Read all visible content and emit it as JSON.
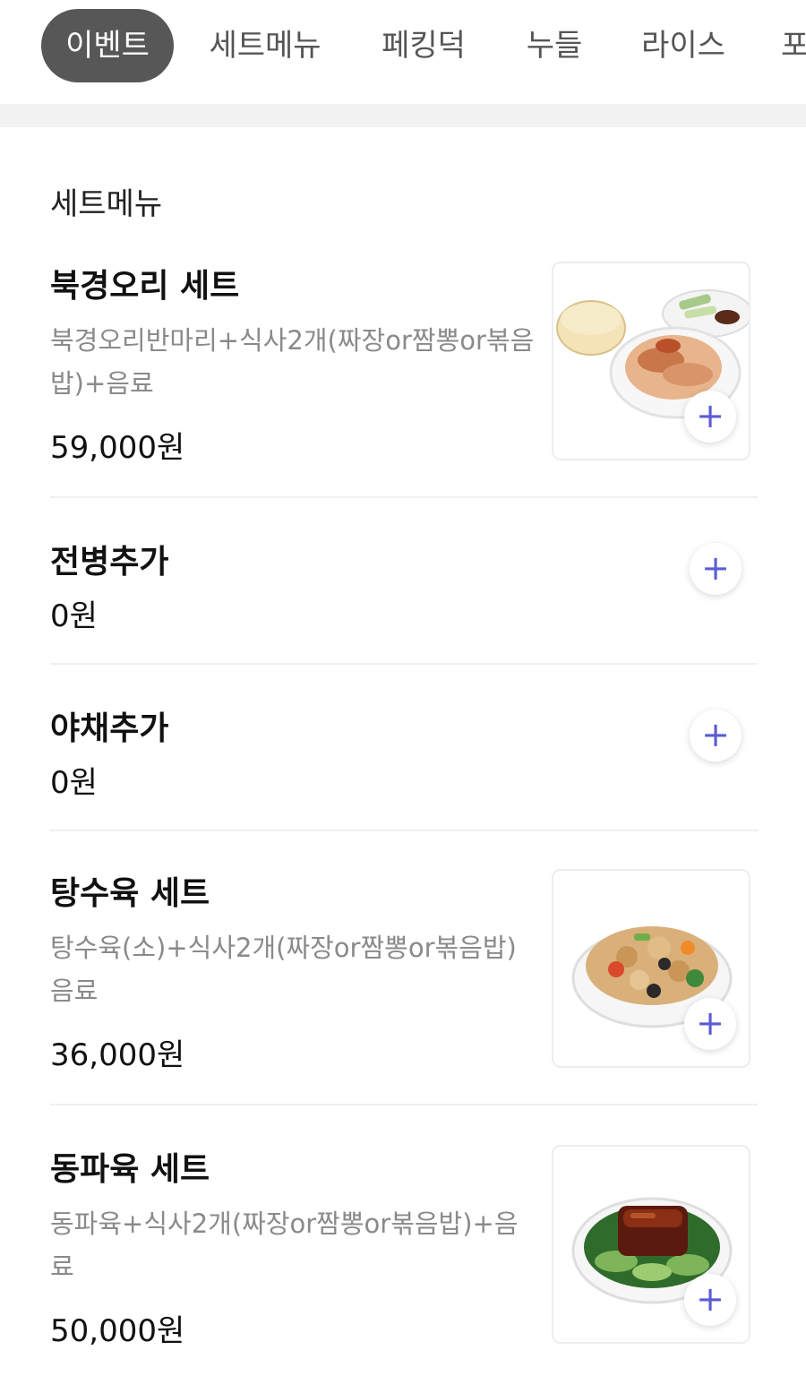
{
  "tabs": [
    {
      "label": "이벤트",
      "active": true
    },
    {
      "label": "세트메뉴",
      "active": false
    },
    {
      "label": "페킹덕",
      "active": false
    },
    {
      "label": "누들",
      "active": false
    },
    {
      "label": "라이스",
      "active": false
    },
    {
      "label": "포",
      "active": false
    }
  ],
  "section": {
    "title": "세트메뉴",
    "items": [
      {
        "name": "북경오리 세트",
        "description": "북경오리반마리+식사2개(짜장or짬뽕or볶음밥)+음료",
        "price": "59,000원",
        "has_image": true,
        "image_icon": "peking-duck-plate"
      },
      {
        "name": "전병추가",
        "description": "",
        "price": "0원",
        "has_image": false
      },
      {
        "name": "야채추가",
        "description": "",
        "price": "0원",
        "has_image": false
      },
      {
        "name": "탕수육 세트",
        "description": "탕수육(소)+식사2개(짜장or짬뽕or볶음밥)음료",
        "price": "36,000원",
        "has_image": true,
        "image_icon": "sweet-sour-pork-plate"
      },
      {
        "name": "동파육 세트",
        "description": "동파육+식사2개(짜장or짬뽕or볶음밥)+음료",
        "price": "50,000원",
        "has_image": true,
        "image_icon": "dongpo-pork-plate"
      }
    ]
  },
  "add_icon": "plus-icon",
  "colors": {
    "active_tab_bg": "#575757",
    "accent": "#5b5bd6",
    "muted_text": "#8a8a8a"
  }
}
